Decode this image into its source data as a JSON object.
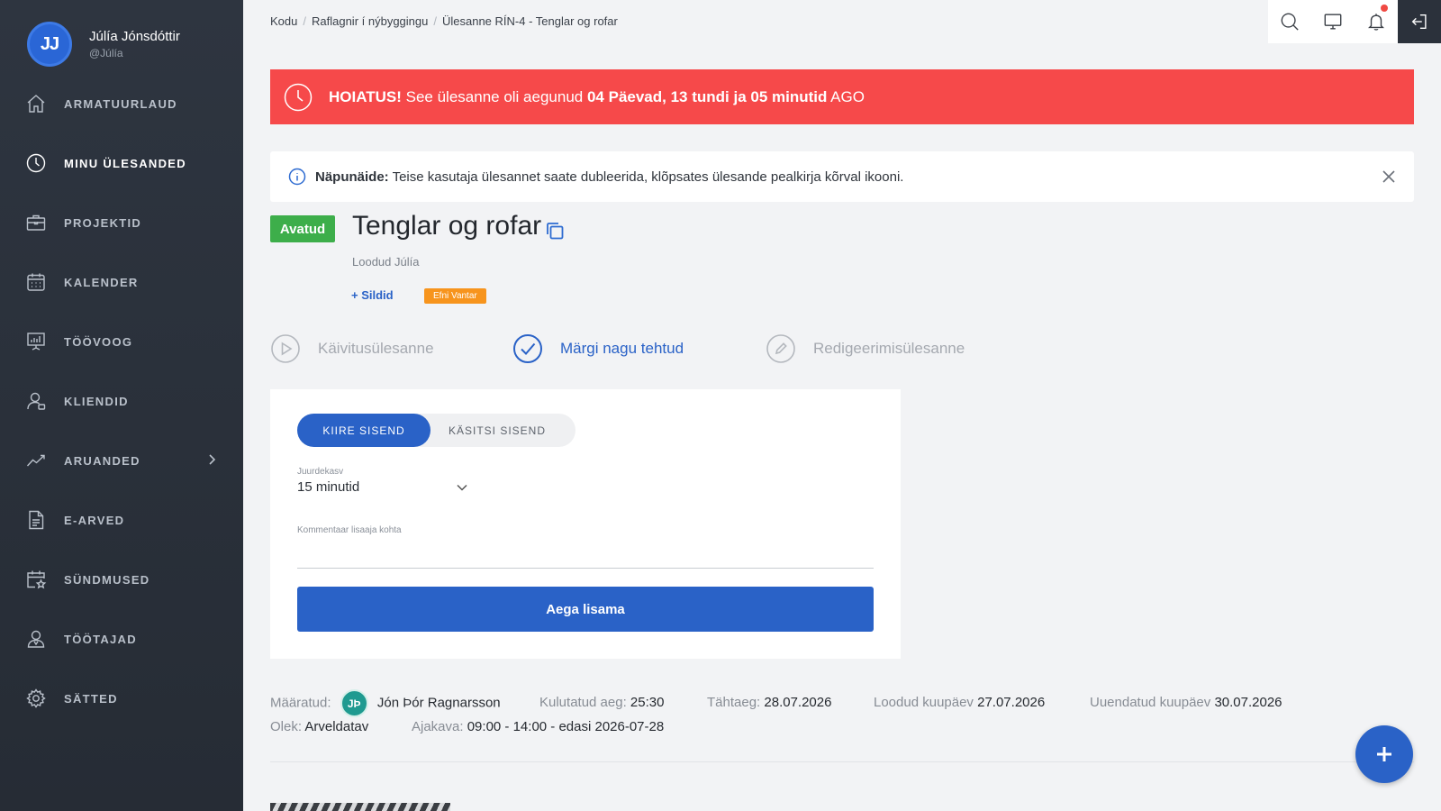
{
  "user": {
    "initials": "JJ",
    "name": "Júlía Jónsdóttir",
    "handle": "@Júlía"
  },
  "sidebar": {
    "items": [
      {
        "label": "ARMATUURLAUD",
        "icon": "home-icon"
      },
      {
        "label": "MINU ÜLESANDED",
        "icon": "clock-icon",
        "active": true
      },
      {
        "label": "PROJEKTID",
        "icon": "briefcase-icon"
      },
      {
        "label": "KALENDER",
        "icon": "calendar-icon"
      },
      {
        "label": "TÖÖVOOG",
        "icon": "workflow-board-icon"
      },
      {
        "label": "KLIENDID",
        "icon": "client-icon"
      },
      {
        "label": "ARUANDED",
        "icon": "chart-line-icon",
        "has_submenu": true
      },
      {
        "label": "E-ARVED",
        "icon": "document-icon"
      },
      {
        "label": "SÜNDMUSED",
        "icon": "event-star-icon"
      },
      {
        "label": "TÖÖTAJAD",
        "icon": "employees-icon"
      },
      {
        "label": "SÄTTED",
        "icon": "gear-icon"
      }
    ]
  },
  "breadcrumb": [
    "Kodu",
    "Raflagnir í nýbyggingu",
    "Ülesanne RÍN-4 - Tenglar og rofar"
  ],
  "topbar": {
    "icons": [
      "search-icon",
      "monitor-icon",
      "bell-icon",
      "logout-icon"
    ]
  },
  "alert": {
    "prefix": "HOIATUS!",
    "text": " See ülesanne oli aegunud ",
    "duration": "04 Päevad, 13 tundi ja 05 minutid",
    "suffix": " AGO",
    "color": "#f6494a"
  },
  "tip": {
    "label": "Näpunäide:",
    "text": " Teise kasutaja ülesannet saate dubleerida, klõpsates ülesande pealkirja kõrval ikooni."
  },
  "task": {
    "status": "Avatud",
    "title": "Tenglar og rofar",
    "created_by": "Loodud Júlía",
    "tags_link": "+ Sildid",
    "tag": "Efni Vantar"
  },
  "actions": {
    "start": "Käivitusülesanne",
    "done": "Märgi nagu tehtud",
    "edit": "Redigeerimisülesanne"
  },
  "time_entry": {
    "tab_quick": "KIIRE SISEND",
    "tab_manual": "KÄSITSI SISEND",
    "increment_label": "Juurdekasv",
    "increment_value": "15 minutid",
    "comment_label": "Kommentaar lisaaja kohta",
    "comment_value": "",
    "submit": "Aega lisama"
  },
  "meta": {
    "assigned_label": "Määratud:",
    "assignee_initials": "JÞ",
    "assignee_name": "Jón Þór Ragnarsson",
    "spent_label": "Kulutatud aeg:",
    "spent_value": "25:30",
    "due_label": "Tähtaeg:",
    "due_value": "28.07.2026",
    "created_label": "Loodud kuupäev",
    "created_value": "27.07.2026",
    "updated_label": "Uuendatud kuupäev",
    "updated_value": "30.07.2026",
    "status_label": "Olek:",
    "status_value": "Arveldatav",
    "schedule_label": "Ajakava:",
    "schedule_value": "09:00 - 14:00 - edasi 2026-07-28"
  },
  "colors": {
    "accent": "#2a62c7",
    "success": "#3dae4a",
    "warning_tag": "#f7941d",
    "sidebar": "#2b323c"
  }
}
